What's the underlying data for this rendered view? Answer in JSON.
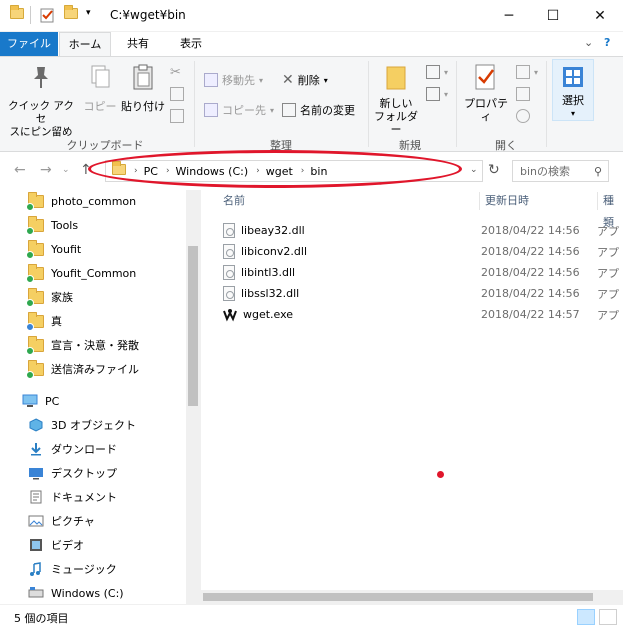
{
  "window": {
    "title": "C:¥wget¥bin",
    "minimize": "─",
    "maximize": "☐",
    "close": "✕"
  },
  "tabs": {
    "file": "ファイル",
    "home": "ホーム",
    "share": "共有",
    "view": "表示"
  },
  "ribbon": {
    "quick_access": "クイック アクセ\nスにピン留め",
    "copy": "コピー",
    "paste": "貼り付け",
    "clipboard_group": "クリップボード",
    "move_to": "移動先",
    "copy_to": "コピー先",
    "delete": "削除",
    "rename": "名前の変更",
    "organize_group": "整理",
    "new_folder": "新しい\nフォルダー",
    "new_group": "新規",
    "properties": "プロパティ",
    "open_group": "開く",
    "select": "選択"
  },
  "address": {
    "crumbs": [
      "PC",
      "Windows (C:)",
      "wget",
      "bin"
    ],
    "search_placeholder": "binの検索"
  },
  "nav": {
    "items": [
      {
        "label": "photo_common",
        "badge": "check"
      },
      {
        "label": "Tools",
        "badge": "check"
      },
      {
        "label": "Youfit",
        "badge": "check"
      },
      {
        "label": "Youfit_Common",
        "badge": "check"
      },
      {
        "label": "家族",
        "badge": "check"
      },
      {
        "label": "真",
        "badge": "sync"
      },
      {
        "label": "宣言・決意・発散",
        "badge": "check"
      },
      {
        "label": "送信済みファイル",
        "badge": "check"
      }
    ],
    "pc_label": "PC",
    "pc_items": [
      {
        "label": "3D オブジェクト",
        "icon": "cube-icon"
      },
      {
        "label": "ダウンロード",
        "icon": "download-icon"
      },
      {
        "label": "デスクトップ",
        "icon": "desktop-icon"
      },
      {
        "label": "ドキュメント",
        "icon": "document-icon"
      },
      {
        "label": "ピクチャ",
        "icon": "picture-icon"
      },
      {
        "label": "ビデオ",
        "icon": "video-icon"
      },
      {
        "label": "ミュージック",
        "icon": "music-icon"
      },
      {
        "label": "Windows (C:)",
        "icon": "drive-icon"
      }
    ]
  },
  "columns": {
    "name": "名前",
    "date": "更新日時",
    "type": "種類"
  },
  "files": [
    {
      "name": "libeay32.dll",
      "date": "2018/04/22 14:56",
      "type": "アプ"
    },
    {
      "name": "libiconv2.dll",
      "date": "2018/04/22 14:56",
      "type": "アプ"
    },
    {
      "name": "libintl3.dll",
      "date": "2018/04/22 14:56",
      "type": "アプ"
    },
    {
      "name": "libssl32.dll",
      "date": "2018/04/22 14:56",
      "type": "アプ"
    },
    {
      "name": "wget.exe",
      "date": "2018/04/22 14:57",
      "type": "アプ"
    }
  ],
  "status": {
    "count": "5 個の項目"
  },
  "colors": {
    "accent": "#1979ca",
    "highlight": "#e0162b"
  }
}
